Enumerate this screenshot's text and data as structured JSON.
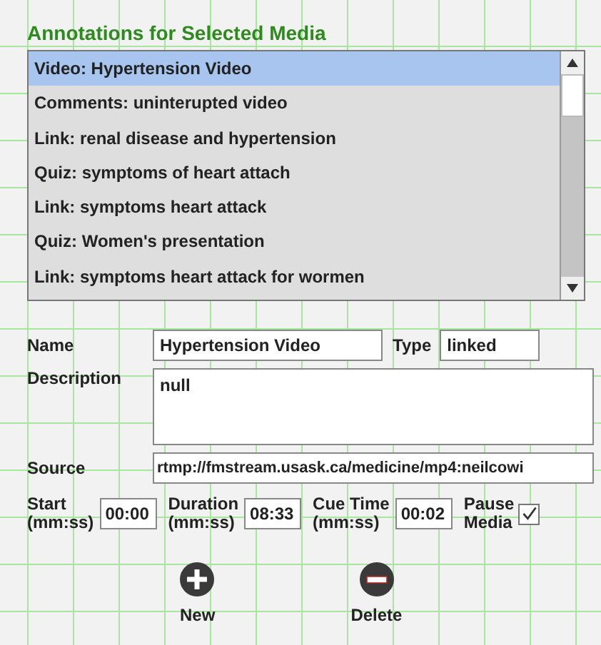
{
  "title": "Annotations for Selected Media",
  "annotations": [
    {
      "label": "Video:  Hypertension Video",
      "selected": true
    },
    {
      "label": "Comments:  uninterupted video",
      "selected": false
    },
    {
      "label": "Link:  renal disease and hypertension",
      "selected": false
    },
    {
      "label": "Quiz:  symptoms of heart attach",
      "selected": false
    },
    {
      "label": "Link:  symptoms heart attack",
      "selected": false
    },
    {
      "label": "Quiz:  Women's presentation",
      "selected": false
    },
    {
      "label": "Link:  symptoms heart attack for wormen",
      "selected": false
    }
  ],
  "form": {
    "name_label": "Name",
    "name": "Hypertension Video",
    "type_label": "Type",
    "type": "linked",
    "description_label": "Description",
    "description": "null",
    "source_label": "Source",
    "source": "rtmp://fmstream.usask.ca/medicine/mp4:neilcowi",
    "start_label": [
      "Start",
      "(mm:ss)"
    ],
    "start": "00:00",
    "duration_label": [
      "Duration",
      "(mm:ss)"
    ],
    "duration": "08:33",
    "cue_label": [
      "Cue Time",
      "(mm:ss)"
    ],
    "cue": "00:02",
    "pause_label": [
      "Pause",
      "Media"
    ],
    "pause_checked": true
  },
  "buttons": [
    {
      "kind": "add",
      "label": "New"
    },
    {
      "kind": "remove",
      "label": "Delete"
    }
  ]
}
